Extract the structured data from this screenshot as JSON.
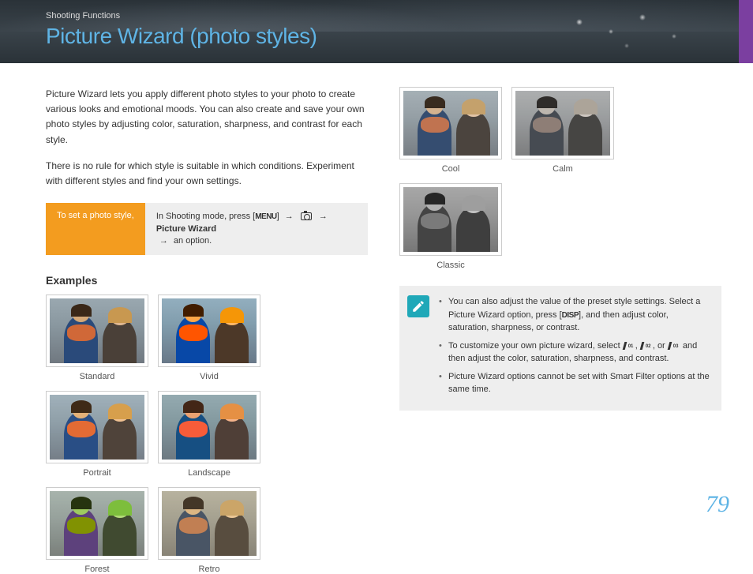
{
  "breadcrumb": "Shooting Functions",
  "title": "Picture Wizard (photo styles)",
  "intro1": "Picture Wizard lets you apply different photo styles to your photo to create various looks and emotional moods. You can also create and save your own photo styles by adjusting color, saturation, sharpness, and contrast for each style.",
  "intro2": "There is no rule for which style is suitable in which conditions. Experiment with different styles and find your own settings.",
  "set_label": "To set a photo style,",
  "instruction": {
    "prefix": "In Shooting mode, press [",
    "menu": "MENU",
    "mid1": "] ",
    "arrow": "→",
    "mid2": " ",
    "target": "Picture Wizard",
    "suffix": " an option."
  },
  "examples_heading": "Examples",
  "styles_left": [
    {
      "label": "Standard",
      "filter": "f-standard"
    },
    {
      "label": "Vivid",
      "filter": "f-vivid"
    },
    {
      "label": "Portrait",
      "filter": "f-portrait"
    },
    {
      "label": "Landscape",
      "filter": "f-landscape"
    },
    {
      "label": "Forest",
      "filter": "f-forest"
    },
    {
      "label": "Retro",
      "filter": "f-retro"
    }
  ],
  "styles_right": [
    {
      "label": "Cool",
      "filter": "f-cool"
    },
    {
      "label": "Calm",
      "filter": "f-calm"
    },
    {
      "label": "Classic",
      "filter": "f-classic"
    }
  ],
  "notes": {
    "n1a": "You can also adjust the value of the preset style settings. Select a Picture Wizard option, press [",
    "disp": "DISP",
    "n1b": "], and then adjust color, saturation, sharpness, or contrast.",
    "n2a": "To customize your own picture wizard, select ",
    "n2b": ", or ",
    "n2c": " and then adjust the color, saturation, sharpness, and contrast.",
    "n3": "Picture Wizard options cannot be set with Smart Filter options at the same time."
  },
  "page": "79"
}
